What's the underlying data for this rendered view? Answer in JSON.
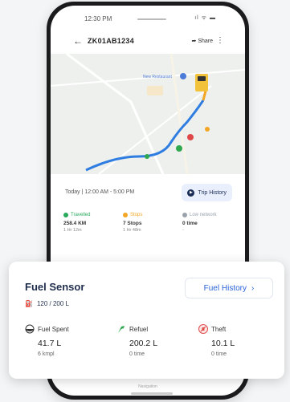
{
  "status_bar": {
    "time": "12:30 PM",
    "icons": "ıl ᯤ ▬"
  },
  "app_bar": {
    "vehicle": "ZK01AB1234",
    "share_label": "Share"
  },
  "map": {
    "place_label": "New Restaurant"
  },
  "trip": {
    "day_text": "Today | 12:00 AM - 5:00 PM",
    "history_label": "Trip History"
  },
  "stats": [
    {
      "label": "Travelled",
      "value": "258.4 KM",
      "sub": "1 Hr 12m",
      "color": "#27a85a"
    },
    {
      "label": "Stops",
      "value": "7 Stops",
      "sub": "1 Hr 48m",
      "color": "#f2a623"
    },
    {
      "label": "Low network",
      "value": "0 time",
      "sub": "-",
      "color": "#9aa3ad"
    }
  ],
  "card": {
    "title": "Fuel Sensor",
    "level": "120 / 200 L",
    "history_label": "Fuel History",
    "metrics": [
      {
        "name": "Fuel Spent",
        "value": "41.7 L",
        "sub": "6 kmpl",
        "icon": "fuel-drop-icon"
      },
      {
        "name": "Refuel",
        "value": "200.2 L",
        "sub": "0 time",
        "icon": "fuel-nozzle-icon"
      },
      {
        "name": "Theft",
        "value": "10.1 L",
        "sub": "0 time",
        "icon": "theft-icon"
      }
    ]
  },
  "bottom_text": "Navigation"
}
